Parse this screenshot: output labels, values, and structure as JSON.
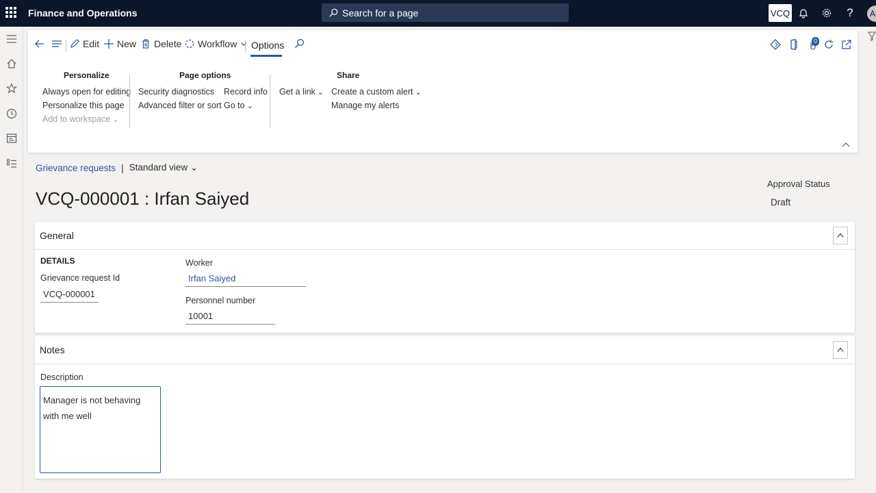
{
  "app": {
    "title": "Finance and Operations",
    "search_label": "Search for a page",
    "company": "VCQ",
    "user_initials": "AD"
  },
  "toolbar": {
    "edit": "Edit",
    "new": "New",
    "delete": "Delete",
    "workflow": "Workflow",
    "options": "Options"
  },
  "action_groups": {
    "personalize": {
      "title": "Personalize",
      "items": [
        "Always open for editing",
        "Personalize this page",
        "Add to workspace"
      ]
    },
    "page_options": {
      "title": "Page options",
      "col1": [
        "Security diagnostics",
        "Advanced filter or sort"
      ],
      "col2": [
        "Record info",
        "Go to"
      ]
    },
    "share": {
      "title": "Share",
      "get_link": "Get a link",
      "items": [
        "Create a custom alert",
        "Manage my alerts"
      ]
    }
  },
  "breadcrumb": {
    "link": "Grievance requests",
    "separator": "|",
    "view": "Standard view"
  },
  "record": {
    "title": "VCQ-000001 : Irfan Saiyed",
    "status_label": "Approval Status",
    "status_value": "Draft"
  },
  "general": {
    "title": "General",
    "details_heading": "DETAILS",
    "request_id_label": "Grievance request Id",
    "request_id": "VCQ-000001",
    "worker_label": "Worker",
    "worker": "Irfan Saiyed",
    "personnel_label": "Personnel number",
    "personnel": "10001"
  },
  "notes": {
    "title": "Notes",
    "description_label": "Description",
    "description": "Manager is not behaving with me well"
  },
  "notifications_badge": "0"
}
